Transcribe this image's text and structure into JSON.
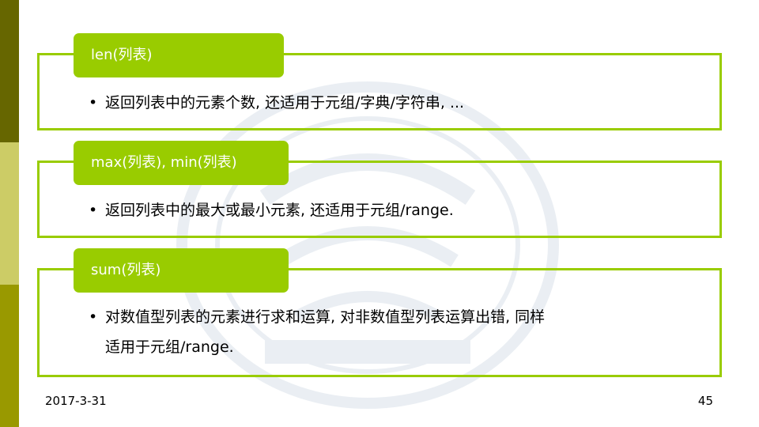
{
  "slide": {
    "sections": [
      {
        "tag": "len(列表)",
        "bullets": [
          "返回列表中的元素个数, 还适用于元组/字典/字符串, ..."
        ]
      },
      {
        "tag": "max(列表), min(列表)",
        "bullets": [
          "返回列表中的最大或最小元素, 还适用于元组/range."
        ]
      },
      {
        "tag": "sum(列表)",
        "bullets": [
          "对数值型列表的元素进行求和运算, 对非数值型列表运算出错, 同样",
          "适用于元组/range."
        ]
      }
    ],
    "footer": {
      "date": "2017-3-31",
      "page_number": "45"
    }
  },
  "colors": {
    "accent": "#99cc00",
    "strip_top": "#666600",
    "strip_mid": "#cccc66",
    "strip_bottom": "#999900"
  }
}
